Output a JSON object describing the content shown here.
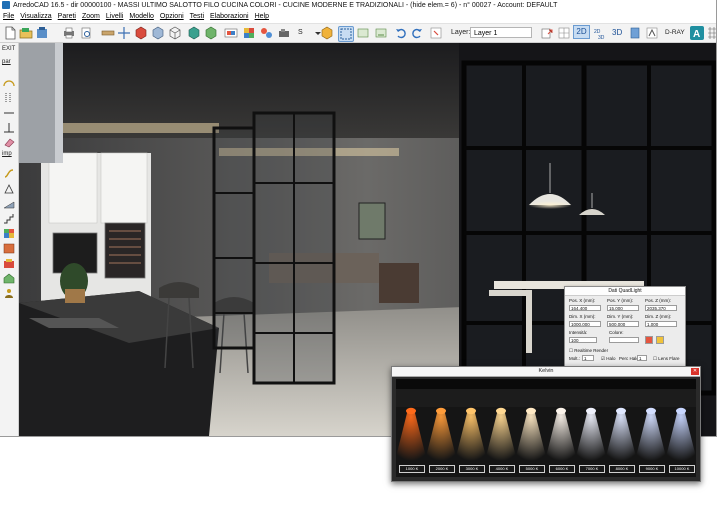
{
  "window": {
    "title": "ArredoCAD 16.5 - dir 00000100 - MASSI ULTIMO SALOTTO FILO CUCINA COLORI - CUCINE MODERNE E TRADIZIONALI - (hide elem.= 6)  - n° 00027 - Account: DEFAULT"
  },
  "menu": {
    "items": [
      "File",
      "Visualizza",
      "Pareti",
      "Zoom",
      "Livelli",
      "Modello",
      "Opzioni",
      "Testi",
      "Elaborazioni",
      "Help"
    ]
  },
  "toolbar": {
    "s_label": "S",
    "layer_label": "Layer:",
    "layer_value": "Layer 1",
    "view_2d": "2D",
    "view_3d": "3D",
    "dray": "D-RAY"
  },
  "sidebar": {
    "exit": "EXIT",
    "par": "par",
    "imp": "imp"
  },
  "quadlight": {
    "title": "Dati QuadLight",
    "pos_x_label": "Pos. X (mm):",
    "pos_y_label": "Pos. Y (mm):",
    "pos_z_label": "Pos. Z (mm):",
    "pos_x": "164.400",
    "pos_y": "15.000",
    "pos_z": "2035.370",
    "dim_x_label": "Dim. X (mm):",
    "dim_y_label": "Dim. Y (mm):",
    "dim_z_label": "Dim. Z (mm):",
    "dim_x": "1000.000",
    "dim_y": "500.000",
    "dim_z": "1.000",
    "intensity_label": "Intensità:",
    "color_label": "Colore:",
    "intensity": "100",
    "realtime_label": "Realtime Render",
    "molt_label": "Molt.:",
    "molt_value": "1",
    "halo_label": "Halo",
    "perc_halo_label": "Perc Halo:",
    "perc_halo_value": "1",
    "lens_flare_label": "Lens Flare"
  },
  "kelvin": {
    "title": "Kelvin",
    "temperatures": [
      "1000 K",
      "2000 K",
      "3000 K",
      "4000 K",
      "5000 K",
      "6000 K",
      "7000 K",
      "8000 K",
      "9000 K",
      "10000 K"
    ],
    "colors": [
      "#ff6a1a",
      "#ff9c3a",
      "#ffc46a",
      "#ffd892",
      "#ffe9c4",
      "#fbf3ea",
      "#eef0fb",
      "#dfe7ff",
      "#d3deff",
      "#c8d6ff"
    ]
  },
  "colors": {
    "accent_2d": "#c7dcf2",
    "close_red": "#d9332a"
  }
}
